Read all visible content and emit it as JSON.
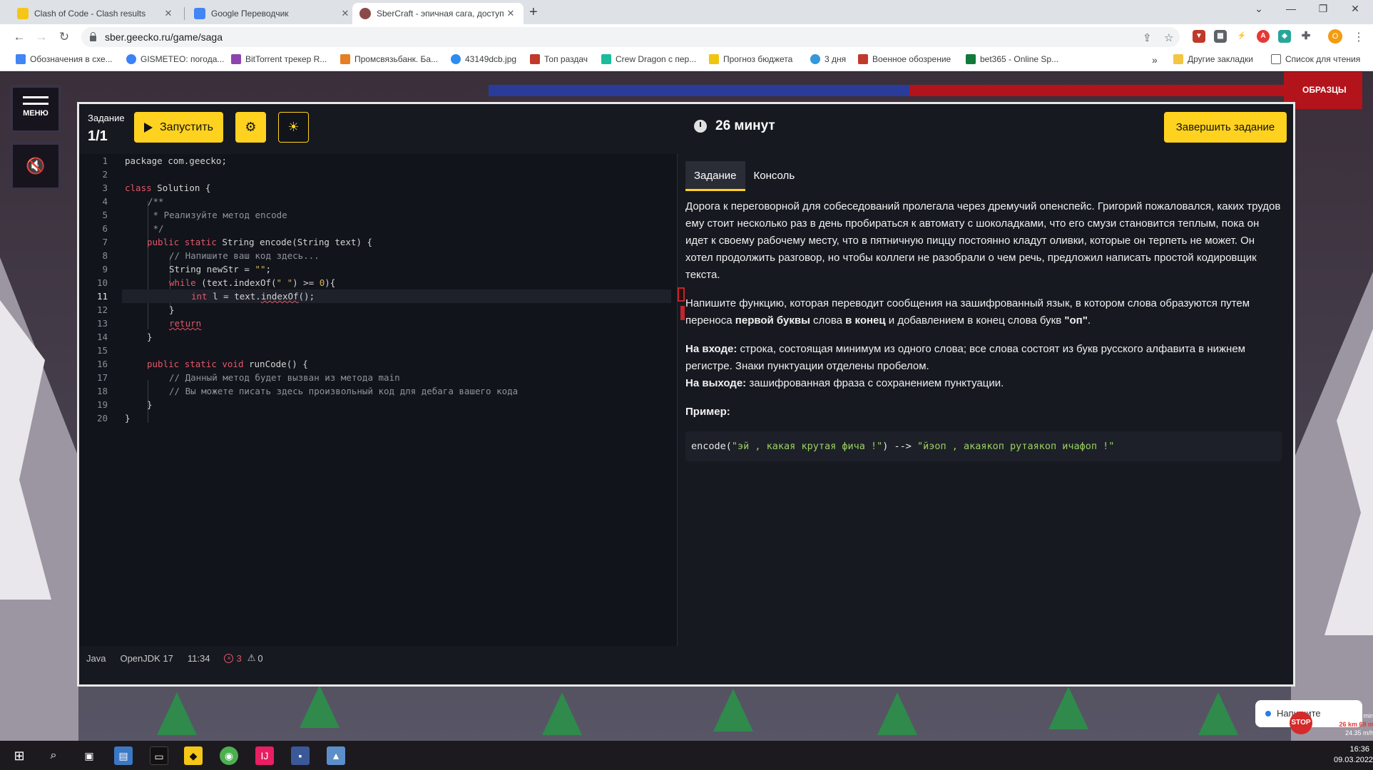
{
  "browser": {
    "tabs": [
      {
        "title": "Clash of Code - Clash results",
        "color": "#f5c518"
      },
      {
        "title": "Google Переводчик",
        "color": "#4285f4"
      },
      {
        "title": "SberCraft - эпичная сага, доступ",
        "color": "#8b4a4a"
      }
    ],
    "url": "sber.geecko.ru/game/saga",
    "bookmarks": [
      {
        "label": "Обозначения в схе...",
        "color": "#4285f4"
      },
      {
        "label": "GISMETEO: погода...",
        "color": "#3b82f6"
      },
      {
        "label": "BitTorrent трекер R...",
        "color": "#8e44ad"
      },
      {
        "label": "Промсвязьбанк. Ба...",
        "color": "#e67e22"
      },
      {
        "label": "43149dcb.jpg",
        "color": "#2d8cf0"
      },
      {
        "label": "Топ раздач",
        "color": "#c0392b"
      },
      {
        "label": "Crew Dragon с пер...",
        "color": "#1abc9c"
      },
      {
        "label": "Прогноз бюджета",
        "color": "#f1c40f"
      },
      {
        "label": "3 дня",
        "color": "#3498db"
      },
      {
        "label": "Военное обозрение",
        "color": "#c0392b"
      },
      {
        "label": "bet365 - Online Sp...",
        "color": "#0f7a3a"
      }
    ],
    "bookmarks_more": "»",
    "other_bookmarks": "Другие закладки",
    "reading_list": "Список для чтения",
    "profile_letter": "O"
  },
  "game": {
    "menu_label": "МЕНЮ",
    "sound_icon": "🔇",
    "banner": "ОБРАЗЦЫ"
  },
  "ide": {
    "task_label": "Задание",
    "task_count": "1/1",
    "run_label": "Запустить",
    "timer": "26 минут",
    "finish_label": "Завершить задание",
    "accent": "#ffd21f",
    "status": {
      "language": "Java",
      "runtime": "OpenJDK 17",
      "cursor": "11:34",
      "errors": "3",
      "warnings": "0"
    },
    "line_numbers": [
      "1",
      "2",
      "3",
      "4",
      "5",
      "6",
      "7",
      "8",
      "9",
      "10",
      "11",
      "12",
      "13",
      "14",
      "15",
      "16",
      "17",
      "18",
      "19",
      "20"
    ],
    "code": {
      "l1": "package com.geecko;",
      "l3a": "class",
      "l3b": " Solution {",
      "l4": "/**",
      "l5": " * Реализуйте метод encode",
      "l6": " */",
      "l7a": "public",
      "l7b": "static",
      "l7c": " String encode(String text) {",
      "l8": "// Напишите ваш код здесь...",
      "l9a": "String newStr = ",
      "l9b": "\"\"",
      "l9c": ";",
      "l10a": "while",
      "l10b": " (text.indexOf(",
      "l10c": "\" \"",
      "l10d": ") >= ",
      "l10e": "0",
      "l10f": "){",
      "l11a": "int",
      "l11b": " l = text.",
      "l11c": "indexOf",
      "l11d": "();",
      "l12": "}",
      "l13": "return",
      "l14": "}",
      "l16a": "public",
      "l16b": "static",
      "l16c": "void",
      "l16d": " runCode() {",
      "l17": "// Данный метод будет вызван из метода main",
      "l18": "// Вы можете писать здесь произвольный код для дебага вашего кода",
      "l19": "}",
      "l20": "}"
    },
    "panel": {
      "tab_task": "Задание",
      "tab_console": "Консоль",
      "p1": "Дорога к переговорной для собеседований пролегала через дремучий опенспейс. Григорий пожаловался, каких трудов ему стоит несколько раз в день пробираться к автомату с шоколадками, что его смузи становится теплым, пока он идет к своему рабочему месту, что в пятничную пиццу постоянно кладут оливки, которые он терпеть не может. Он хотел продолжить разговор, но чтобы коллеги не разобрали о чем речь, предложил написать простой кодировщик текста.",
      "p2a": "Напишите функцию, которая переводит сообщения на зашифрованный язык, в котором слова образуются путем переноса ",
      "p2b": "первой буквы",
      "p2c": " слова ",
      "p2d": "в конец",
      "p2e": " и добавлением в конец слова букв ",
      "p2f": "\"оп\"",
      "p2g": ".",
      "input_label": "На входе:",
      "input_text": " строка, состоящая минимум из одного слова; все слова состоят из букв русского алфавита в нижнем регистре. Знаки пунктуации отделены пробелом.",
      "output_label": "На выходе:",
      "output_text": " зашифрованная фраза с сохранением пунктуации.",
      "example_label": "Пример:",
      "example_fn": "encode(",
      "example_in": "\"эй , какая крутая фича !\"",
      "example_arrow": ") --> ",
      "example_out": "\"йэоп , акаякоп рутаякоп ичафоп !\""
    }
  },
  "overlay": {
    "toast": "Напишите",
    "stop": "STOP",
    "speed_line1": "1070 h 31 min",
    "speed_line2": "26 km 69 m",
    "speed_line3": "24.35 m/h"
  },
  "taskbar": {
    "time": "16:36",
    "date": "09.03.2022"
  }
}
